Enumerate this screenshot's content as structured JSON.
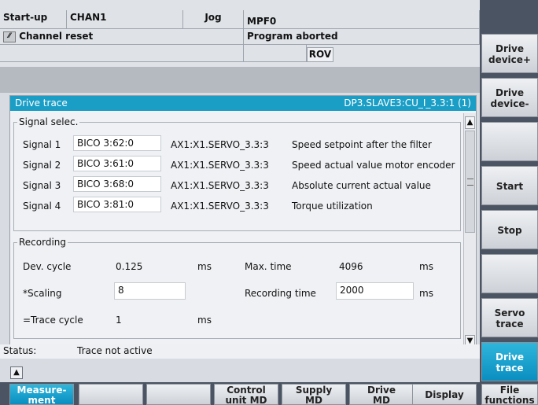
{
  "status": {
    "mode": "Start-up",
    "channel": "CHAN1",
    "op_mode": "Jog",
    "program": "MPF0",
    "reset": "Channel reset",
    "program_state": "Program aborted",
    "rov": "ROV"
  },
  "panel": {
    "title": "Drive trace",
    "device": "DP3.SLAVE3:CU_I_3.3:1 (1)"
  },
  "signal_section": {
    "title": "Signal selec.",
    "rows": [
      {
        "label": "Signal 1",
        "bico": "BICO 3:62:0",
        "axis": "AX1:X1.SERVO_3.3:3",
        "desc": "Speed setpoint after the filter"
      },
      {
        "label": "Signal 2",
        "bico": "BICO 3:61:0",
        "axis": "AX1:X1.SERVO_3.3:3",
        "desc": "Speed actual value motor encoder"
      },
      {
        "label": "Signal 3",
        "bico": "BICO 3:68:0",
        "axis": "AX1:X1.SERVO_3.3:3",
        "desc": "Absolute current actual value"
      },
      {
        "label": "Signal 4",
        "bico": "BICO 3:81:0",
        "axis": "AX1:X1.SERVO_3.3:3",
        "desc": "Torque utilization"
      }
    ]
  },
  "recording": {
    "title": "Recording",
    "dev_cycle_label": "Dev. cycle",
    "dev_cycle_value": "0.125",
    "dev_cycle_unit": "ms",
    "max_time_label": "Max. time",
    "max_time_value": "4096",
    "max_time_unit": "ms",
    "scaling_label": "*Scaling",
    "scaling_value": "8",
    "recording_time_label": "Recording time",
    "recording_time_value": "2000",
    "recording_time_unit": "ms",
    "trace_cycle_label": "=Trace cycle",
    "trace_cycle_value": "1",
    "trace_cycle_unit": "ms"
  },
  "status_line": {
    "label": "Status:",
    "value": "Trace not active"
  },
  "right_softkeys": [
    "",
    "Drive\ndevice+",
    "Drive\ndevice-",
    "",
    "Start",
    "Stop",
    "",
    "Servo\ntrace",
    "Drive\ntrace"
  ],
  "bottom_softkeys": [
    "Measure-\nment",
    "",
    "",
    "Control\nunit MD",
    "Supply\nMD",
    "Drive\nMD",
    "Display",
    "File\nfunctions"
  ],
  "colors": {
    "accent": "#1b9ec6",
    "softkey_active": "#0a8ec0",
    "softkey_bar": "#4b5463"
  }
}
